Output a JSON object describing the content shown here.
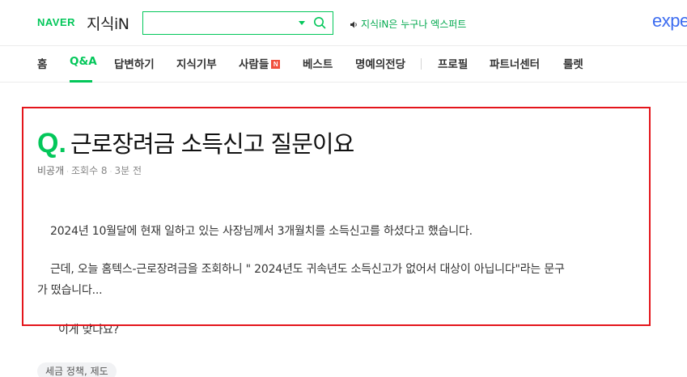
{
  "header": {
    "naver_logo": "NAVER",
    "service_name": "지식iN",
    "search": {
      "value": "",
      "placeholder": ""
    },
    "notice": "지식iN은 누구나 엑스퍼트",
    "expert_logo": "expe"
  },
  "nav": {
    "items": [
      {
        "label": "홈"
      },
      {
        "label": "Q&A"
      },
      {
        "label": "답변하기"
      },
      {
        "label": "지식기부"
      },
      {
        "label": "사람들",
        "badge": "N"
      },
      {
        "label": "베스트"
      },
      {
        "label": "명예의전당"
      },
      {
        "label": "프로필"
      },
      {
        "label": "파트너센터"
      },
      {
        "label": "룰렛"
      }
    ],
    "active": "Q&A"
  },
  "question": {
    "q_mark": "Q",
    "title": "근로장려금 소득신고 질문이요",
    "author": "비공개",
    "views": "조회수 8",
    "time": "3분 전",
    "body": [
      "2024년 10월달에 현재 일하고 있는 사장님께서 3개월치를 소득신고를 하셨다고 했습니다.",
      "근데, 오늘 홈텍스-근로장려금을 조회하니 \" 2024년도 귀속년도 소득신고가 없어서 대상이 아닙니다\"라는 문구",
      "가 떴습니다...",
      "이게 맞나요?"
    ],
    "tags": [
      "세금 정책, 제도"
    ]
  },
  "colors": {
    "brand_green": "#03c75a",
    "highlight_red": "#e4151b",
    "expert_blue": "#3c6cf0",
    "badge_red": "#f04f3d"
  }
}
